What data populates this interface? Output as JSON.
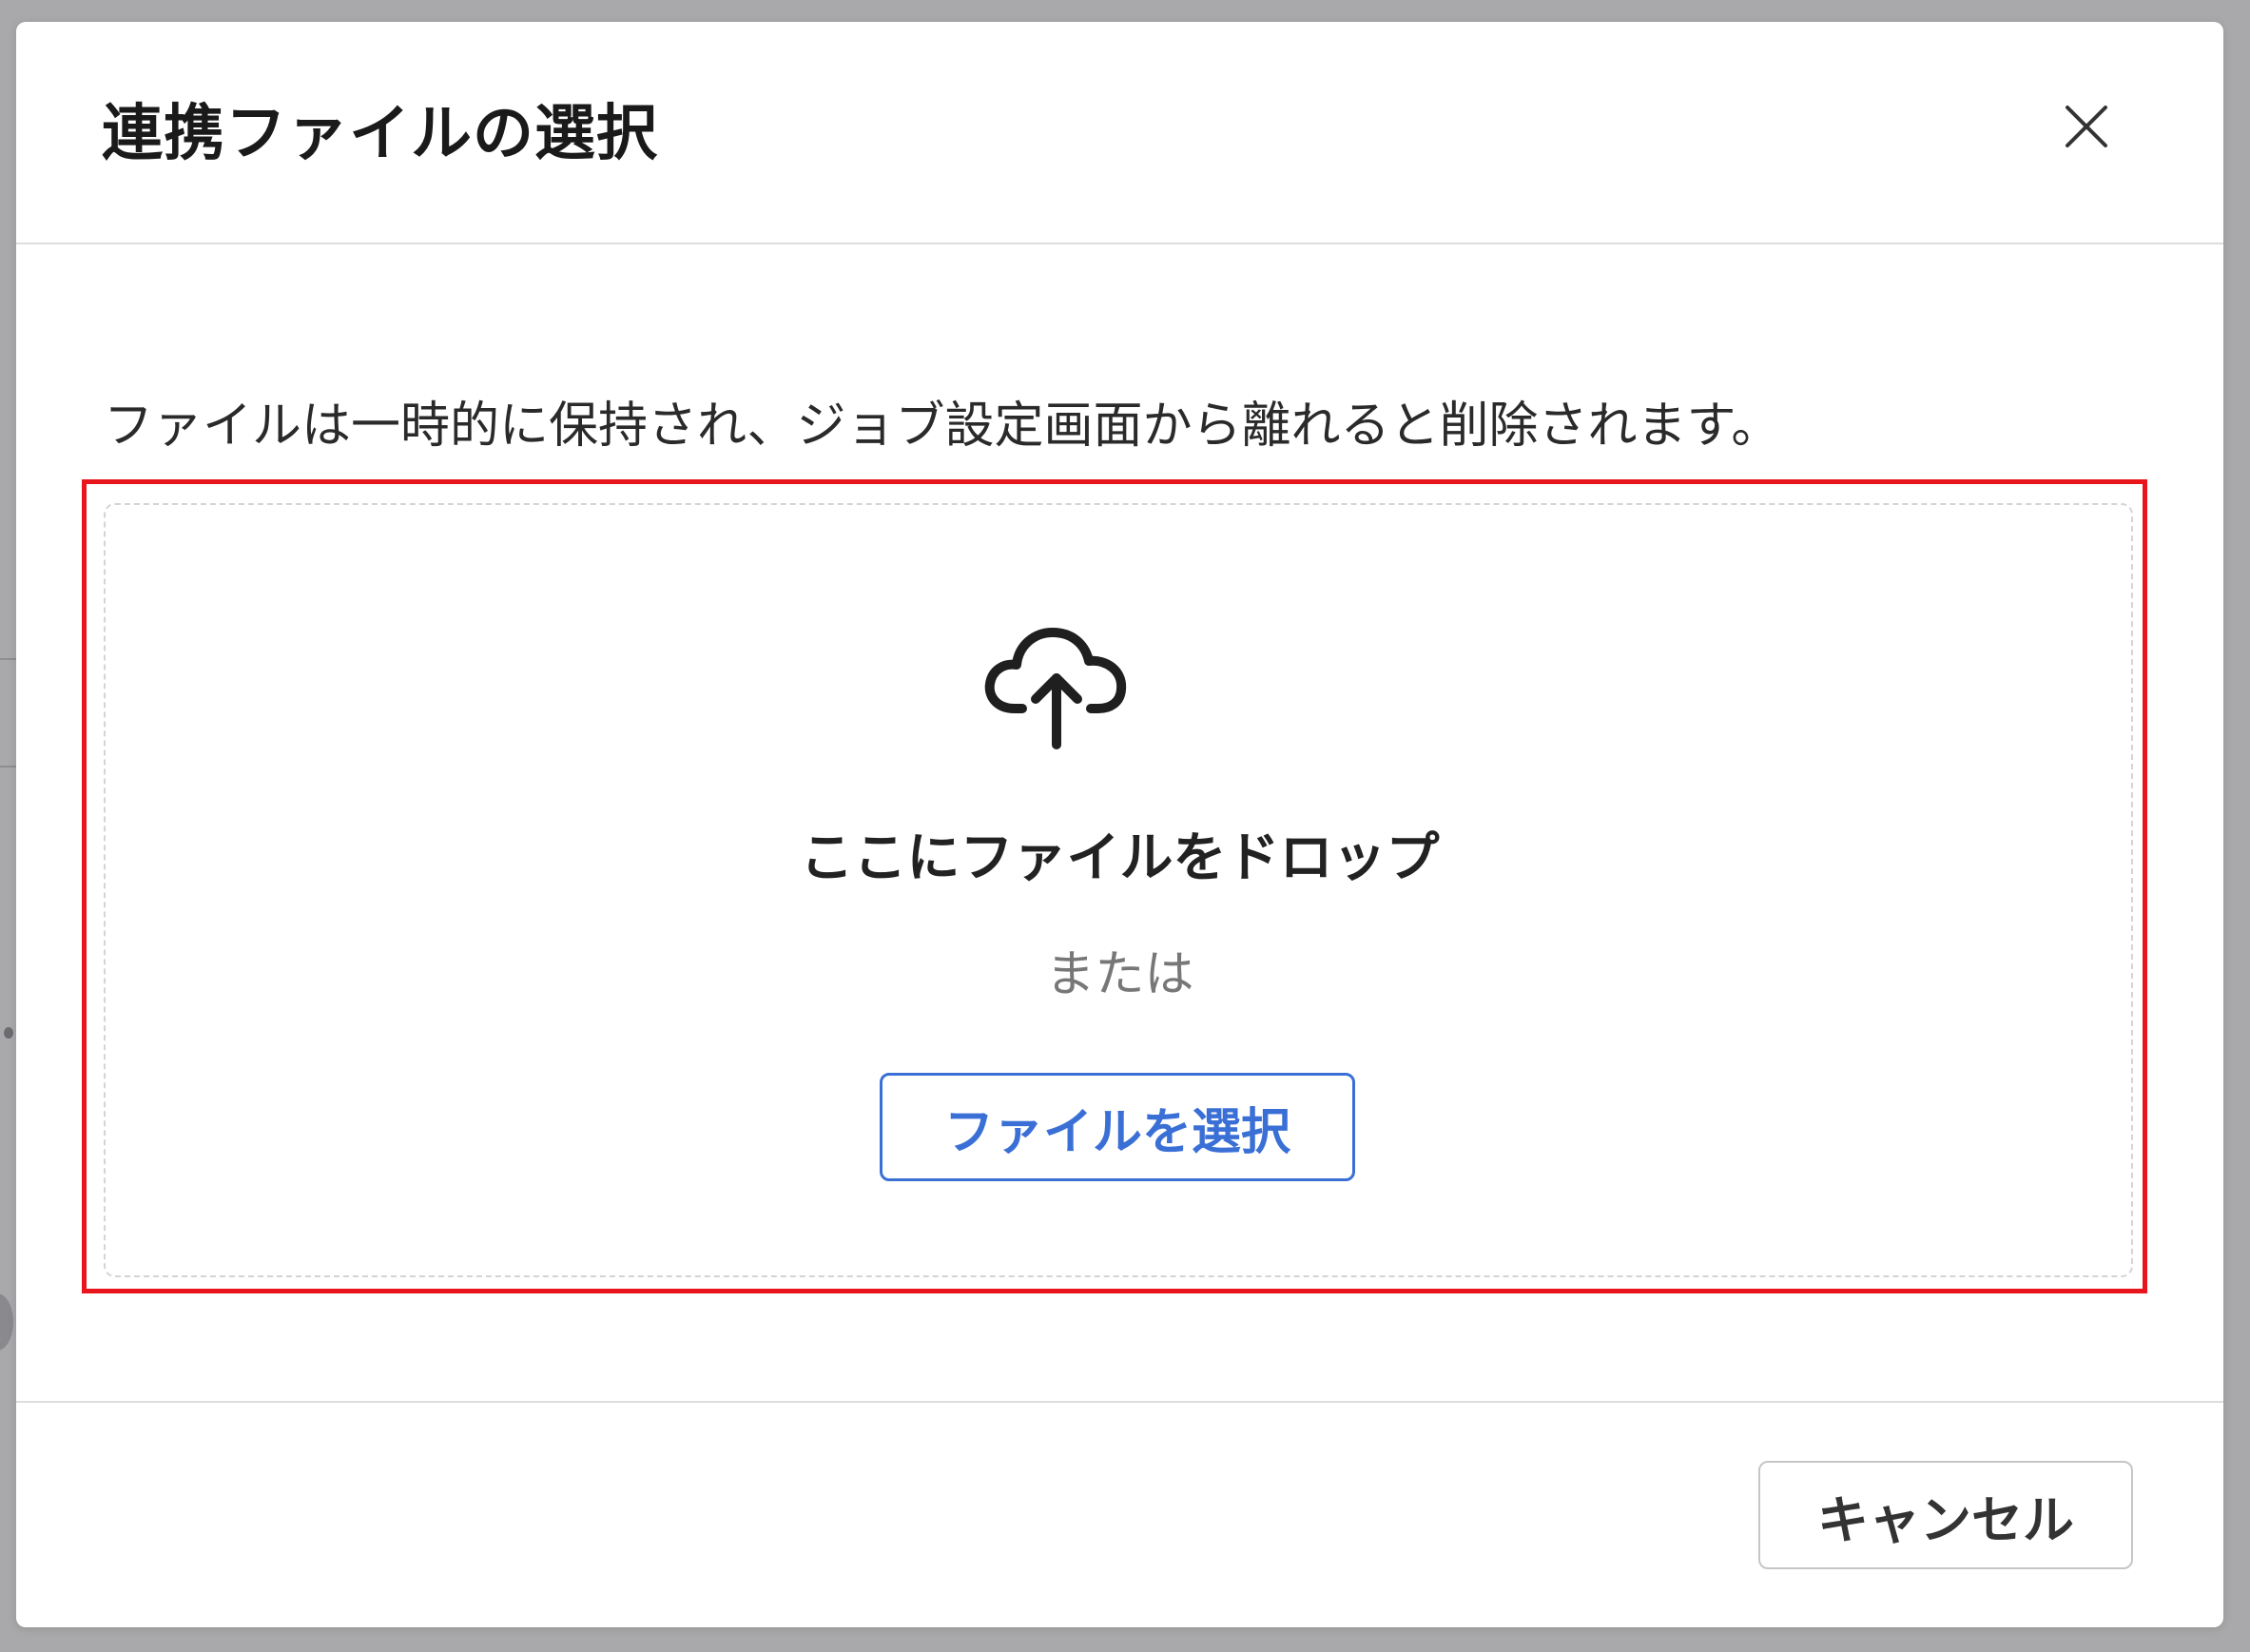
{
  "dialog": {
    "title": "連携ファイルの選択",
    "close_icon": "close-icon"
  },
  "body": {
    "info_text": "ファイルは一時的に保持され、ジョブ設定画面から離れると削除されます。",
    "drop_zone": {
      "icon": "cloud-upload-icon",
      "title": "ここにファイルをドロップ",
      "or_text": "または",
      "select_button_label": "ファイルを選択"
    }
  },
  "footer": {
    "cancel_label": "キャンセル"
  },
  "colors": {
    "accent": "#3a6fd6",
    "highlight": "#e8161c",
    "backdrop": "#a9a9ab"
  }
}
